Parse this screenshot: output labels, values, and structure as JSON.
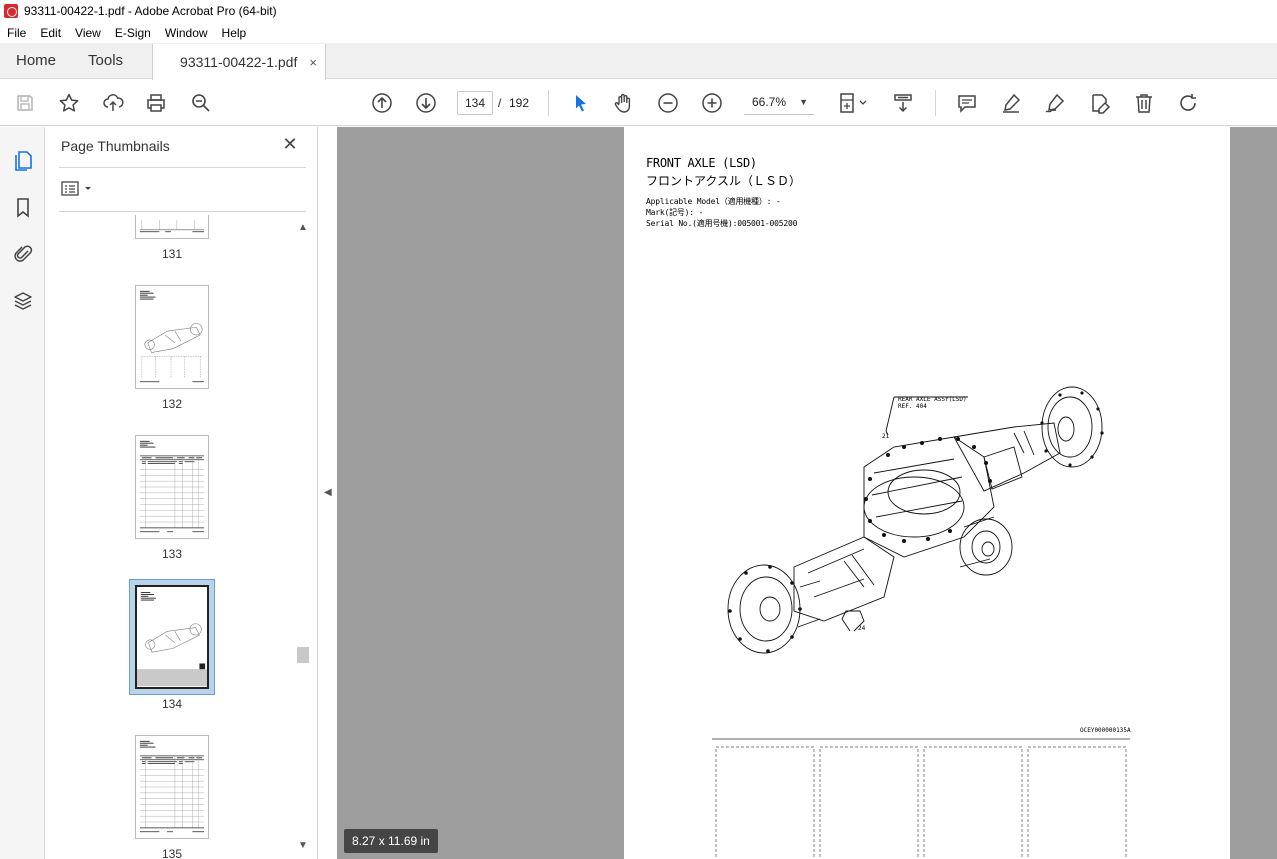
{
  "window": {
    "title": "93311-00422-1.pdf - Adobe Acrobat Pro (64-bit)"
  },
  "menu": [
    "File",
    "Edit",
    "View",
    "E-Sign",
    "Window",
    "Help"
  ],
  "tabs": {
    "home": "Home",
    "tools": "Tools",
    "document": "93311-00422-1.pdf",
    "close": "×"
  },
  "toolbar": {
    "current_page": "134",
    "separator": "/",
    "total_pages": "192",
    "zoom": "66.7%",
    "icons": [
      "save-icon",
      "bookmark-star-icon",
      "share-upload-icon",
      "print-icon",
      "search-zoom-icon",
      "previous-page-icon",
      "next-page-icon",
      "select-cursor-icon",
      "hand-tool-icon",
      "zoom-out-icon",
      "zoom-in-icon",
      "page-fit-icon",
      "scroll-mode-icon",
      "comment-icon",
      "highlight-pen-icon",
      "sign-pen-icon",
      "edit-pdf-icon",
      "delete-icon",
      "rotate-icon"
    ]
  },
  "thumbnail_panel": {
    "title": "Page Thumbnails",
    "close": "✕",
    "pages": [
      "131",
      "132",
      "133",
      "134",
      "135"
    ],
    "selected_page": "134"
  },
  "page": {
    "title_en": "FRONT AXLE (LSD)",
    "title_jp": "フロントアクスル（ＬＳＤ）",
    "model": "Applicable Model（適用機種）: -",
    "mark": "Mark(記号): -",
    "serial": "Serial No.(適用号機):005001-005200",
    "ref_label1": "REAR AXLE ASSY(LSD)",
    "ref_label2": "REF. 404",
    "callout_21": "21",
    "callout_24": "24",
    "drawing_code": "OCEY000000135A"
  },
  "status": {
    "page_size": "8.27 x 11.69 in"
  }
}
